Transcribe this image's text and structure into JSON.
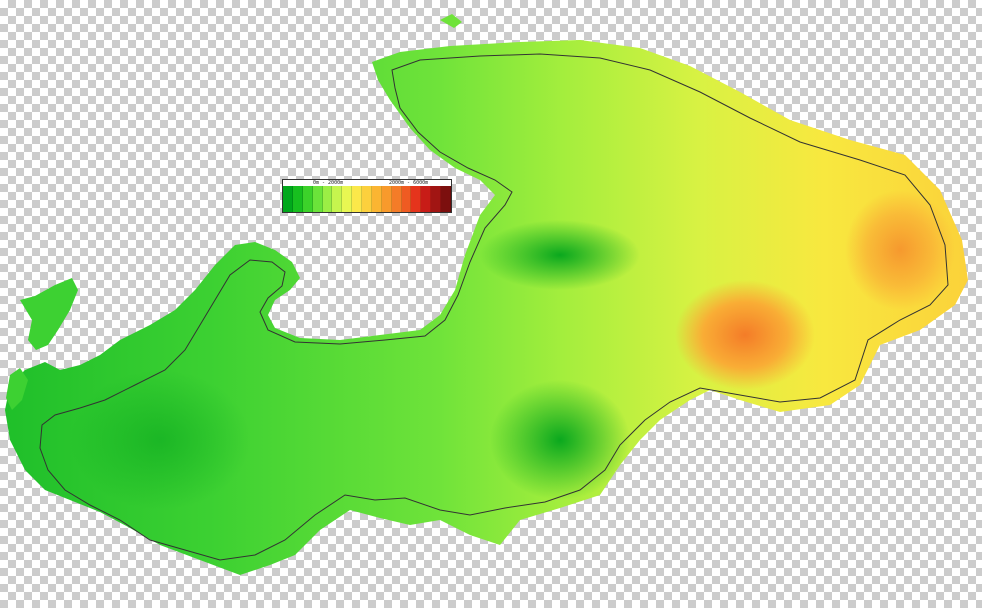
{
  "legend": {
    "label_low": "0m - 2000m",
    "label_high": "2000m - 6000m",
    "swatches": [
      "#00a81c",
      "#17bf1f",
      "#3cd22a",
      "#6be33a",
      "#9bee45",
      "#c6f54e",
      "#e8f752",
      "#fbe84a",
      "#fcd03d",
      "#fbb532",
      "#f89a2c",
      "#f47c28",
      "#ef5b22",
      "#e5341c",
      "#c81c17",
      "#a11513",
      "#7c0f0e"
    ]
  },
  "colors": {
    "boundary": "#333333",
    "lowland": "#3dd132",
    "midland": "#a4ee3d",
    "upland": "#f8e83f",
    "peak": "#f59a2e"
  }
}
